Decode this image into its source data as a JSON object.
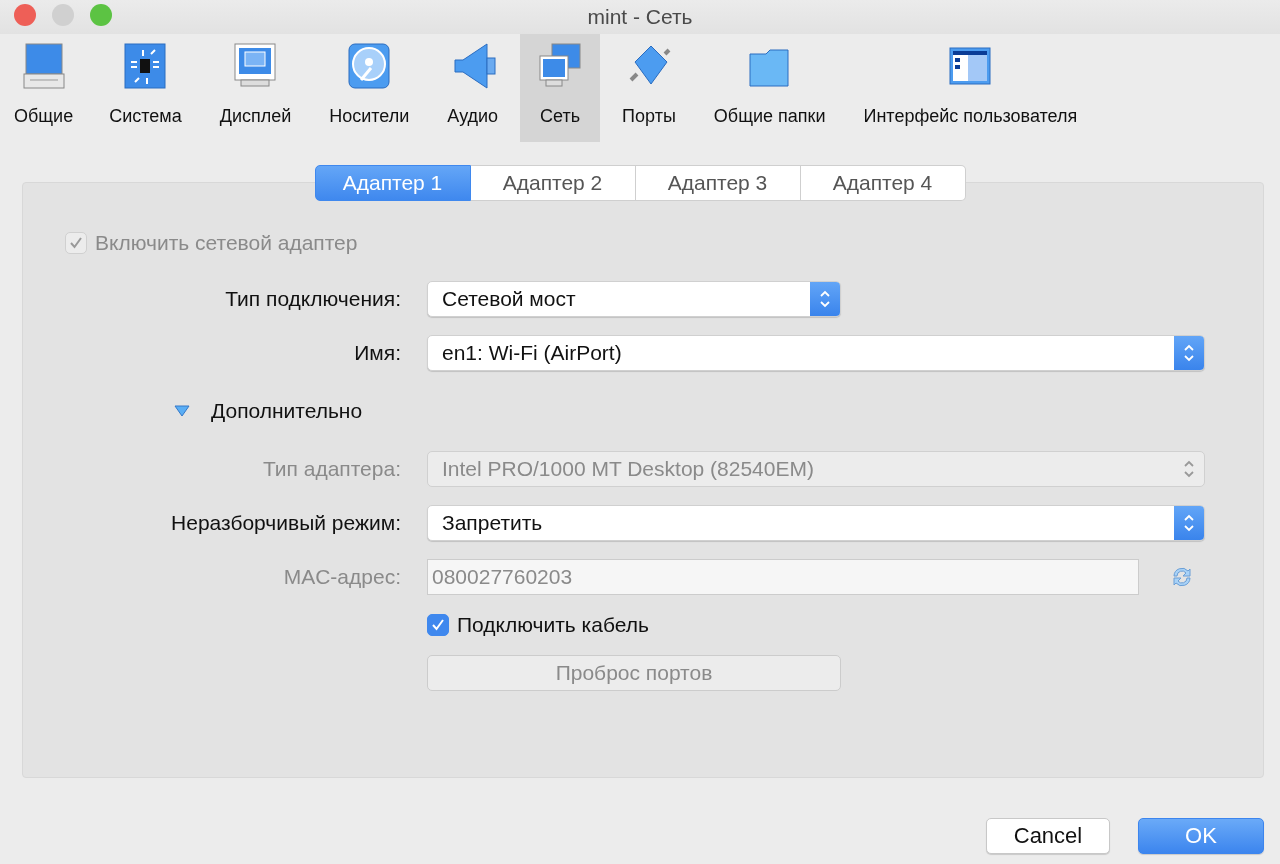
{
  "window": {
    "title": "mint - Сеть"
  },
  "toolbar": [
    {
      "label": "Общие",
      "selected": false
    },
    {
      "label": "Система",
      "selected": false
    },
    {
      "label": "Дисплей",
      "selected": false
    },
    {
      "label": "Носители",
      "selected": false
    },
    {
      "label": "Аудио",
      "selected": false
    },
    {
      "label": "Сеть",
      "selected": true
    },
    {
      "label": "Порты",
      "selected": false
    },
    {
      "label": "Общие папки",
      "selected": false
    },
    {
      "label": "Интерфейс пользователя",
      "selected": false
    }
  ],
  "tabs": [
    {
      "label": "Адаптер 1",
      "selected": true
    },
    {
      "label": "Адаптер 2",
      "selected": false
    },
    {
      "label": "Адаптер 3",
      "selected": false
    },
    {
      "label": "Адаптер 4",
      "selected": false
    }
  ],
  "rows": [
    {
      "kind": "checkbox",
      "label": "Включить сетевой адаптер",
      "checked": true,
      "disabled": true
    },
    {
      "kind": "select",
      "label": "Тип подключения:",
      "value": "Сетевой мост",
      "disabled": false
    },
    {
      "kind": "select",
      "label": "Имя:",
      "value": "en1: Wi-Fi (AirPort)",
      "disabled": false
    },
    {
      "kind": "disclosure",
      "label": "Дополнительно",
      "expanded": true
    },
    {
      "kind": "select",
      "label": "Тип адаптера:",
      "value": "Intel PRO/1000 MT Desktop (82540EM)",
      "disabled": true
    },
    {
      "kind": "select",
      "label": "Неразборчивый режим:",
      "value": "Запретить",
      "disabled": false
    },
    {
      "kind": "text",
      "label": "MAC-адрес:",
      "value": "080027760203",
      "disabled": true
    },
    {
      "kind": "checkbox",
      "label": "Подключить кабель",
      "checked": true,
      "disabled": false
    },
    {
      "kind": "button",
      "label": "Проброс портов",
      "disabled": true
    }
  ],
  "buttons": [
    {
      "label": "Cancel",
      "kind": "secondary"
    },
    {
      "label": "OK",
      "kind": "default"
    }
  ]
}
